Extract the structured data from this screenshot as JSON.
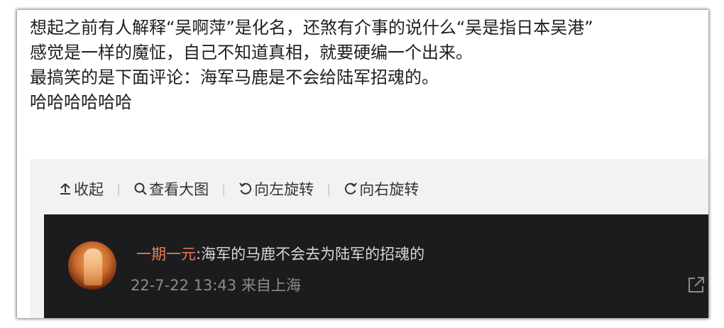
{
  "post": {
    "lines": [
      "想起之前有人解释“吴啊萍”是化名，还煞有介事的说什么“吴是指日本吴港”",
      "感觉是一样的魔怔，自己不知道真相，就要硬编一个出来。",
      "最搞笑的是下面评论：海军马鹿是不会给陆军招魂的。",
      "哈哈哈哈哈哈"
    ]
  },
  "toolbar": {
    "collapse_label": "收起",
    "view_large_label": "查看大图",
    "rotate_left_label": "向左旋转",
    "rotate_right_label": "向右旋转",
    "separator": "|"
  },
  "image_comment": {
    "username": "一期一元",
    "text": ":海军的马鹿不会去为陆军的招魂的",
    "timestamp": "22-7-22 13:43",
    "location": "来自上海"
  },
  "colors": {
    "username": "#e87f58",
    "dark_bg": "#1c1c1f",
    "panel_bg": "#f2f2f2"
  }
}
